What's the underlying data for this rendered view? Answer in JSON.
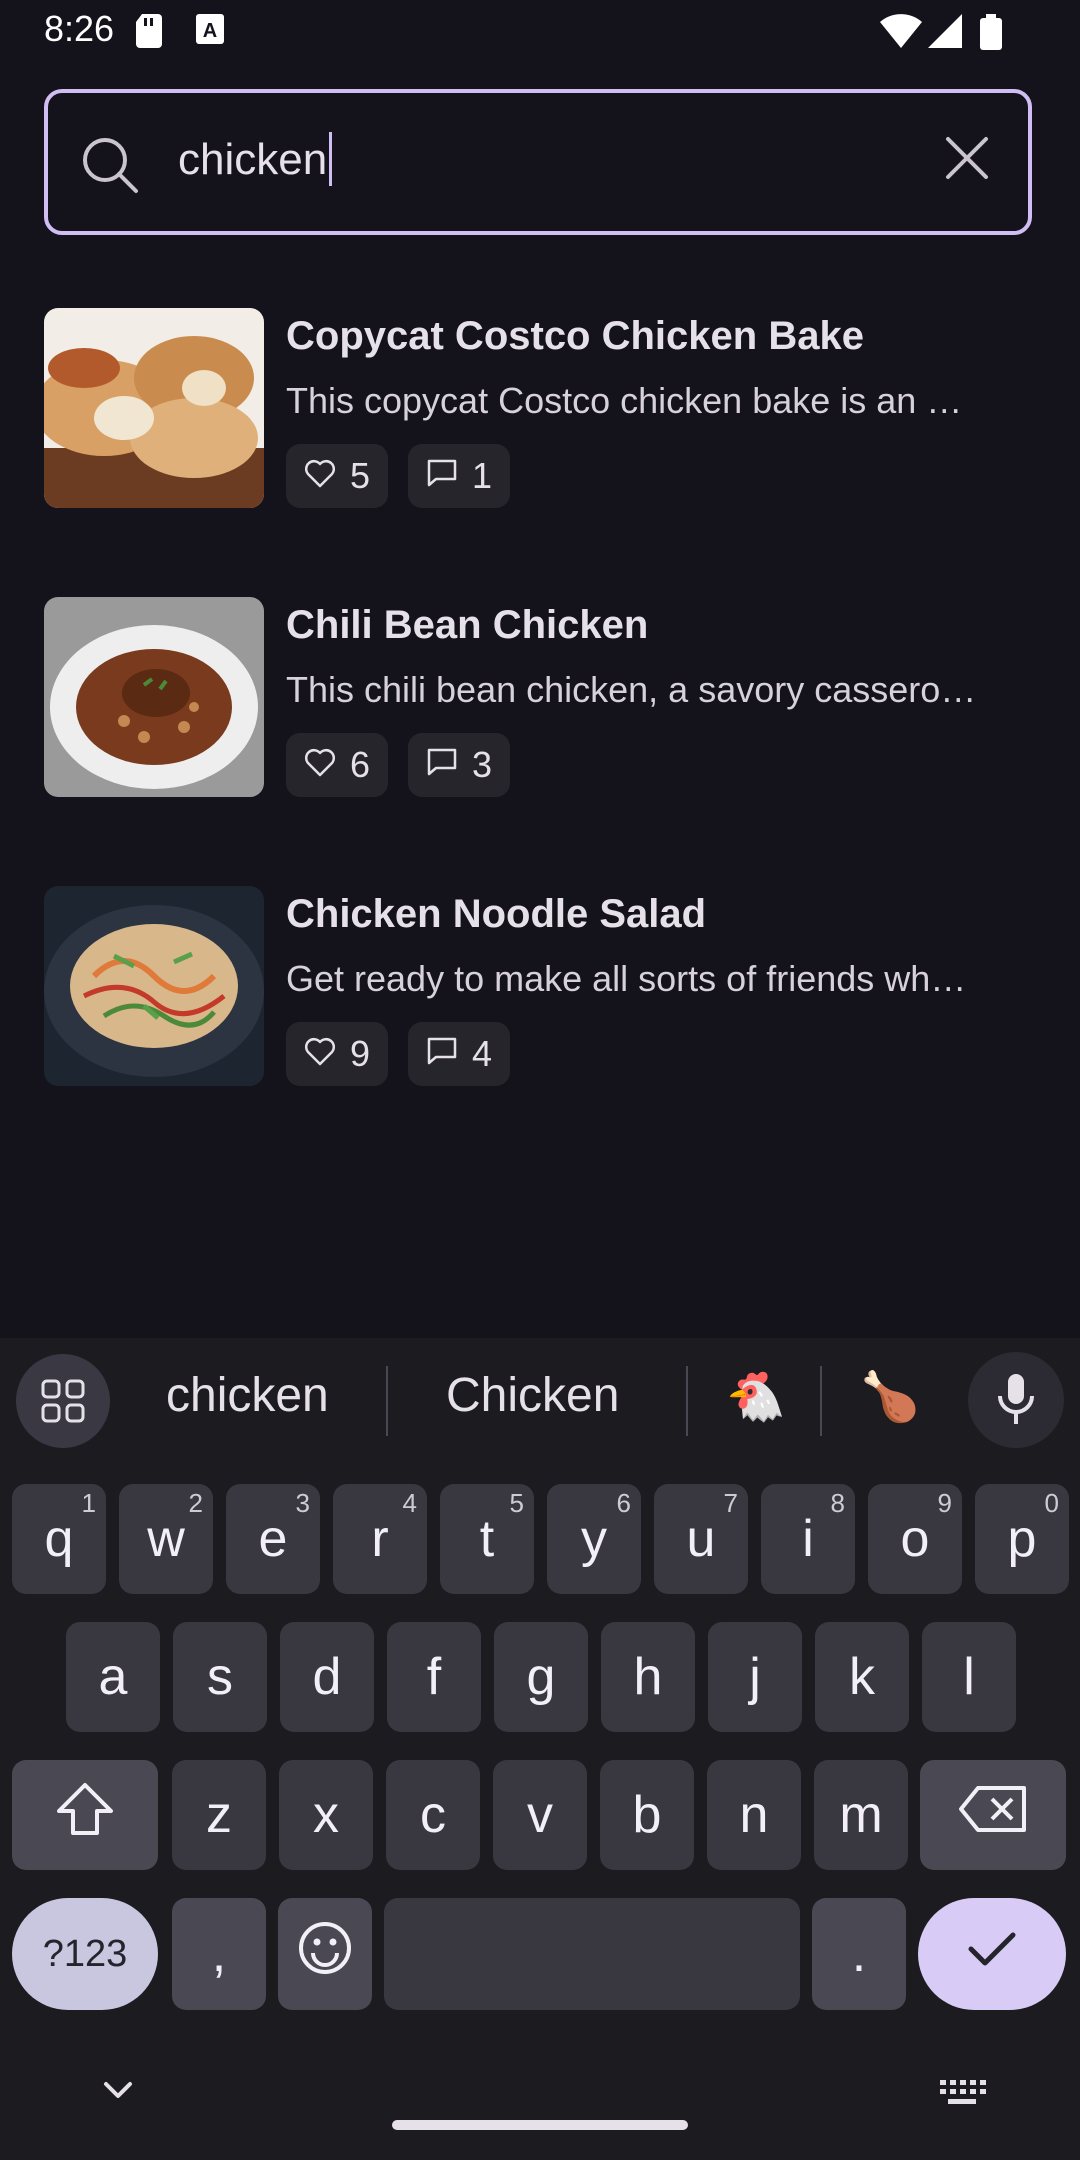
{
  "status_bar": {
    "time": "8:26"
  },
  "search": {
    "query": "chicken"
  },
  "results": [
    {
      "title": "Copycat Costco Chicken Bake",
      "description": "This copycat Costco chicken bake is an …",
      "likes": "5",
      "comments": "1"
    },
    {
      "title": "Chili Bean Chicken",
      "description": "This chili bean chicken, a savory cassero…",
      "likes": "6",
      "comments": "3"
    },
    {
      "title": "Chicken Noodle Salad",
      "description": "Get ready to make all sorts of friends wh…",
      "likes": "9",
      "comments": "4"
    }
  ],
  "keyboard": {
    "suggestions": [
      "chicken",
      "Chicken",
      "🐔",
      "🍗"
    ],
    "row1": [
      {
        "k": "q",
        "h": "1"
      },
      {
        "k": "w",
        "h": "2"
      },
      {
        "k": "e",
        "h": "3"
      },
      {
        "k": "r",
        "h": "4"
      },
      {
        "k": "t",
        "h": "5"
      },
      {
        "k": "y",
        "h": "6"
      },
      {
        "k": "u",
        "h": "7"
      },
      {
        "k": "i",
        "h": "8"
      },
      {
        "k": "o",
        "h": "9"
      },
      {
        "k": "p",
        "h": "0"
      }
    ],
    "row2": [
      "a",
      "s",
      "d",
      "f",
      "g",
      "h",
      "j",
      "k",
      "l"
    ],
    "row3": [
      "z",
      "x",
      "c",
      "v",
      "b",
      "n",
      "m"
    ],
    "symbols_label": "?123",
    "comma": ",",
    "period": "."
  },
  "colors": {
    "background": "#14121a",
    "accent": "#cfbdf3",
    "key": "#393841"
  }
}
